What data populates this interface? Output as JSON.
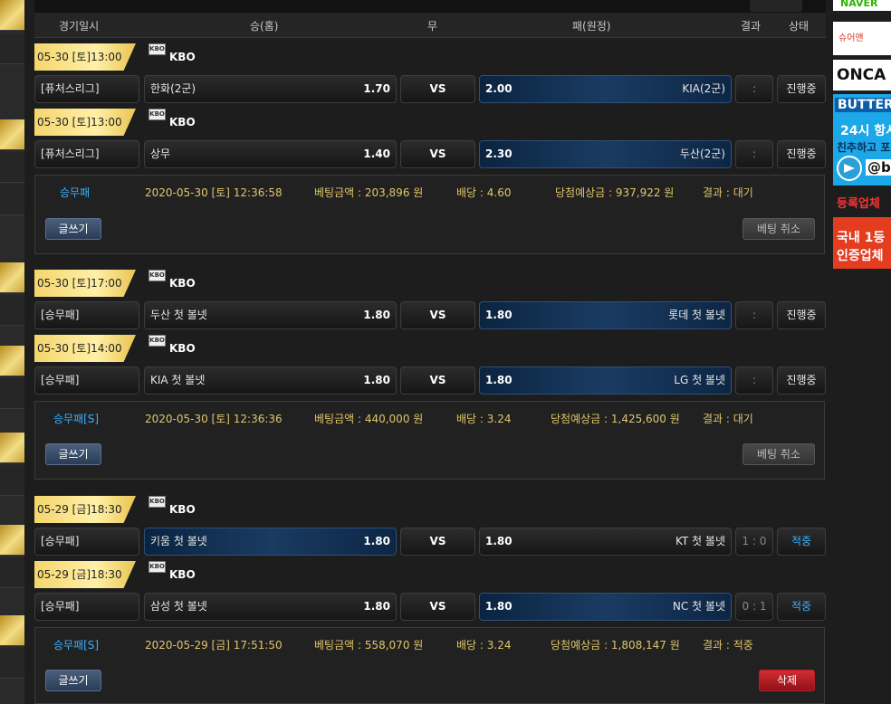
{
  "header": {
    "date": "경기일시",
    "home": "승(홈)",
    "draw": "무",
    "away": "패(원정)",
    "result": "결과",
    "status": "상태"
  },
  "groups": [
    {
      "matches": [
        {
          "date": "05-30 [토]13:00",
          "league": "KBO",
          "type": "[퓨처스리그]",
          "home": "한화(2군)",
          "home_odds": "1.70",
          "vs": "VS",
          "away_odds": "2.00",
          "away": "KIA(2군)",
          "score": ":",
          "status": "진행중"
        },
        {
          "date": "05-30 [토]13:00",
          "league": "KBO",
          "type": "[퓨처스리그]",
          "home": "상무",
          "home_odds": "1.40",
          "vs": "VS",
          "away_odds": "2.30",
          "away": "두산(2군)",
          "score": ":",
          "status": "진행중"
        }
      ],
      "summary": {
        "kind": "승무패",
        "time": "2020-05-30 [토] 12:36:58",
        "amount": "베팅금액 : 203,896 원",
        "odds": "배당 : 4.60",
        "win": "당첨예상금 : 937,922 원",
        "result": "결과 : 대기"
      },
      "write_label": "글쓰기",
      "action_label": "베팅 취소"
    },
    {
      "matches": [
        {
          "date": "05-30 [토]17:00",
          "league": "KBO",
          "type": "[승무패]",
          "home": "두산 첫 볼넷",
          "home_odds": "1.80",
          "vs": "VS",
          "away_odds": "1.80",
          "away": "롯데 첫 볼넷",
          "score": ":",
          "status": "진행중"
        },
        {
          "date": "05-30 [토]14:00",
          "league": "KBO",
          "type": "[승무패]",
          "home": "KIA 첫 볼넷",
          "home_odds": "1.80",
          "vs": "VS",
          "away_odds": "1.80",
          "away": "LG 첫 볼넷",
          "score": ":",
          "status": "진행중"
        }
      ],
      "summary": {
        "kind": "승무패[S]",
        "time": "2020-05-30 [토] 12:36:36",
        "amount": "베팅금액 : 440,000 원",
        "odds": "배당 : 3.24",
        "win": "당첨예상금 : 1,425,600 원",
        "result": "결과 : 대기"
      },
      "write_label": "글쓰기",
      "action_label": "베팅 취소"
    },
    {
      "matches": [
        {
          "date": "05-29 [금]18:30",
          "league": "KBO",
          "type": "[승무패]",
          "home": "키움 첫 볼넷",
          "home_odds": "1.80",
          "vs": "VS",
          "away_odds": "1.80",
          "away": "KT 첫 볼넷",
          "score": "1 : 0",
          "status": "적중"
        },
        {
          "date": "05-29 [금]18:30",
          "league": "KBO",
          "type": "[승무패]",
          "home": "삼성 첫 볼넷",
          "home_odds": "1.80",
          "vs": "VS",
          "away_odds": "1.80",
          "away": "NC 첫 볼넷",
          "score": "0 : 1",
          "status": "적중"
        }
      ],
      "summary": {
        "kind": "승무패[S]",
        "time": "2020-05-29 [금] 17:51:50",
        "amount": "베팅금액 : 558,070 원",
        "odds": "배당 : 3.24",
        "win": "당첨예상금 : 1,808,147 원",
        "result": "결과 : 적중"
      },
      "write_label": "글쓰기",
      "action_label": "삭제"
    }
  ],
  "ads": {
    "naver": "NAVER",
    "sharp": "슈어맨",
    "onca": "ONCA",
    "butter_title": "BUTTER",
    "butter_line1": "24시 항시",
    "butter_line2": "친추하고 포",
    "butter_handle": "@b",
    "reg_title": "등록업체 ",
    "reg_line1": "국내 1등",
    "reg_line2": "인증업체"
  }
}
